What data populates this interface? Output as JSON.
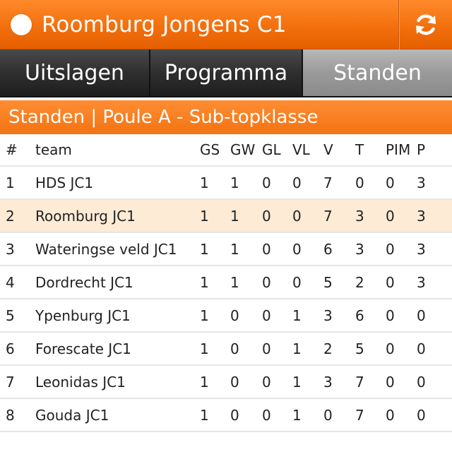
{
  "app": {
    "title": "Roomburg Jongens C1",
    "refresh_icon": "refresh-icon",
    "status_icon": "status-dot-icon"
  },
  "tabs": [
    {
      "label": "Uitslagen",
      "active": false
    },
    {
      "label": "Programma",
      "active": false
    },
    {
      "label": "Standen",
      "active": true
    }
  ],
  "section": {
    "title": "Standen | Poule A - Sub-topklasse"
  },
  "table": {
    "headers": {
      "rank": "#",
      "team": "team",
      "gs": "GS",
      "gw": "GW",
      "gl": "GL",
      "vl": "VL",
      "v": "V",
      "t": "T",
      "pim": "PIM",
      "p": "P"
    },
    "rows": [
      {
        "rank": "1",
        "team": "HDS JC1",
        "gs": "1",
        "gw": "1",
        "gl": "0",
        "vl": "0",
        "v": "7",
        "t": "0",
        "pim": "0",
        "p": "3"
      },
      {
        "rank": "2",
        "team": "Roomburg JC1",
        "gs": "1",
        "gw": "1",
        "gl": "0",
        "vl": "0",
        "v": "7",
        "t": "3",
        "pim": "0",
        "p": "3",
        "highlight": true
      },
      {
        "rank": "3",
        "team": "Wateringse veld JC1",
        "gs": "1",
        "gw": "1",
        "gl": "0",
        "vl": "0",
        "v": "6",
        "t": "3",
        "pim": "0",
        "p": "3"
      },
      {
        "rank": "4",
        "team": "Dordrecht JC1",
        "gs": "1",
        "gw": "1",
        "gl": "0",
        "vl": "0",
        "v": "5",
        "t": "2",
        "pim": "0",
        "p": "3"
      },
      {
        "rank": "5",
        "team": "Ypenburg JC1",
        "gs": "1",
        "gw": "0",
        "gl": "0",
        "vl": "1",
        "v": "3",
        "t": "6",
        "pim": "0",
        "p": "0"
      },
      {
        "rank": "6",
        "team": "Forescate JC1",
        "gs": "1",
        "gw": "0",
        "gl": "0",
        "vl": "1",
        "v": "2",
        "t": "5",
        "pim": "0",
        "p": "0"
      },
      {
        "rank": "7",
        "team": "Leonidas JC1",
        "gs": "1",
        "gw": "0",
        "gl": "0",
        "vl": "1",
        "v": "3",
        "t": "7",
        "pim": "0",
        "p": "0"
      },
      {
        "rank": "8",
        "team": "Gouda JC1",
        "gs": "1",
        "gw": "0",
        "gl": "0",
        "vl": "1",
        "v": "0",
        "t": "7",
        "pim": "0",
        "p": "0"
      }
    ]
  },
  "colors": {
    "accent": "#f26d0b",
    "highlight_row": "#fdebd6",
    "tab_dark": "#2f2f2f",
    "tab_active": "#9a9a9a"
  }
}
